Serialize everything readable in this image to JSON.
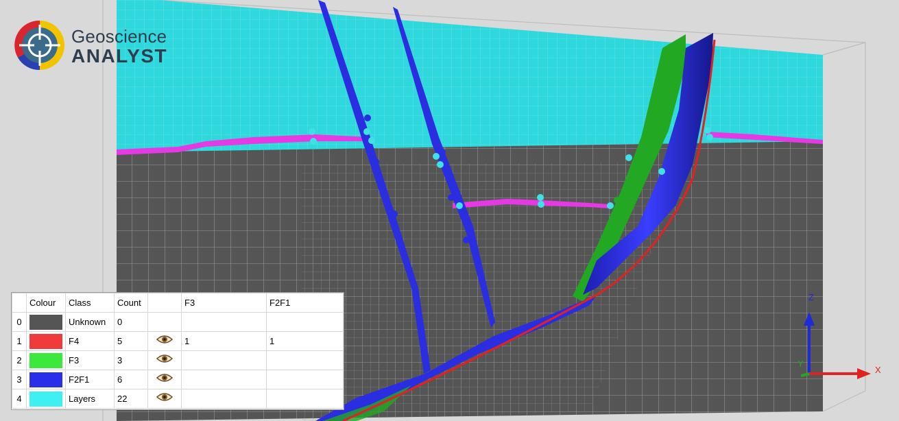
{
  "app": {
    "logo_line1": "Geoscience",
    "logo_line2": "ANALYST"
  },
  "colors": {
    "background": "#d9d9d9",
    "cyan_layer": "#2ed8dc",
    "magenta_layer": "#e53ae3",
    "grey_unknown": "#555555",
    "fault_blue": "#2a2ee0",
    "fault_green": "#22a822",
    "fault_red": "#e02222"
  },
  "legend": {
    "headers": [
      "",
      "Colour",
      "Class",
      "Count",
      "",
      "F3",
      "F2F1"
    ],
    "rows": [
      {
        "index": "0",
        "color": "#555555",
        "class": "Unknown",
        "count": "0",
        "visible": false,
        "f3": "",
        "f2f1": ""
      },
      {
        "index": "1",
        "color": "#f03b3b",
        "class": "F4",
        "count": "5",
        "visible": true,
        "f3": "1",
        "f2f1": "1"
      },
      {
        "index": "2",
        "color": "#3de83d",
        "class": "F3",
        "count": "3",
        "visible": true,
        "f3": "",
        "f2f1": ""
      },
      {
        "index": "3",
        "color": "#2a2ee8",
        "class": "F2F1",
        "count": "6",
        "visible": true,
        "f3": "",
        "f2f1": ""
      },
      {
        "index": "4",
        "color": "#3ff0f2",
        "class": "Layers",
        "count": "22",
        "visible": true,
        "f3": "",
        "f2f1": ""
      }
    ]
  },
  "axes": {
    "x_label": "X",
    "y_label": "Y",
    "z_label": "Z"
  },
  "icons": {
    "visibility": "eye-icon",
    "logo": "geoscience-logo-icon"
  }
}
